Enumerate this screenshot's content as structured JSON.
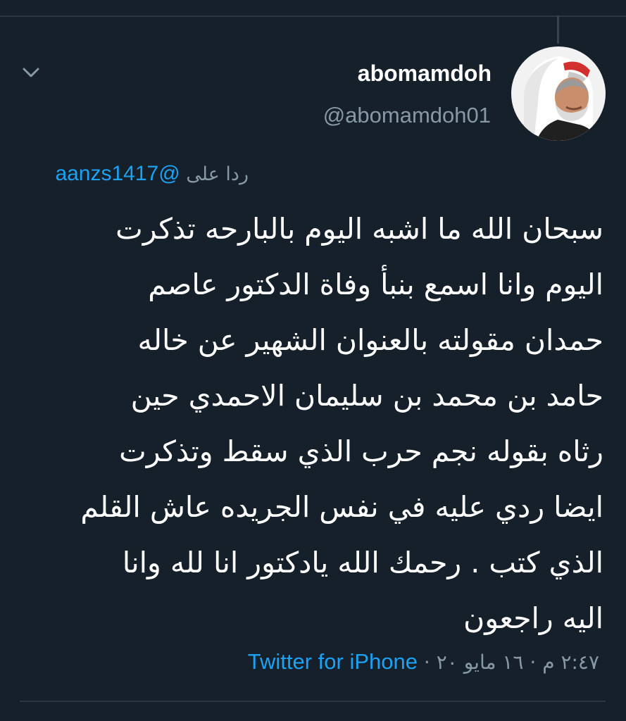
{
  "tweet": {
    "display_name": "abomamdoh",
    "handle": "@abomamdoh01",
    "reply_prefix": "ردا على",
    "reply_mention": "@aanzs1417",
    "body_lines": [
      "سبحان الله ما اشبه اليوم بالبارحه  تذكرت",
      "اليوم وانا اسمع بنبأ وفاة الدكتور عاصم",
      "حمدان مقولته بالعنوان الشهير عن خاله",
      "حامد بن محمد بن سليمان الاحمدي حين",
      "رثاه بقوله نجم حرب الذي سقط وتذكرت",
      "ايضا ردي عليه في نفس الجريده عاش القلم",
      "الذي كتب . رحمك الله يادكتور انا لله وانا",
      "اليه راجعون"
    ],
    "time": "٢:٤٧ م",
    "date": "١٦ مايو ٢٠",
    "separator": "·",
    "source": "Twitter for iPhone"
  },
  "icons": {
    "menu": "chevron-down-icon"
  },
  "colors": {
    "background": "#15202b",
    "text": "#ffffff",
    "secondary": "#8899a6",
    "link": "#1da1f2",
    "divider": "#2b3640"
  }
}
